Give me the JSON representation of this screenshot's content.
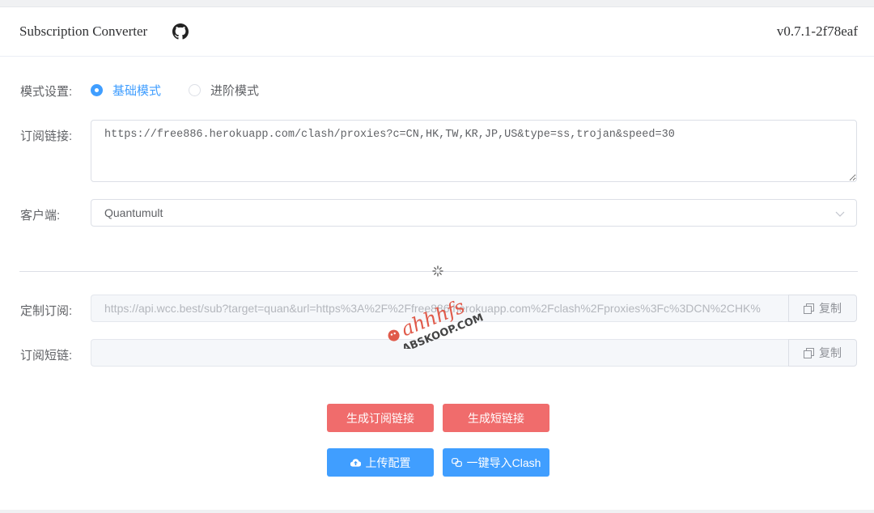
{
  "header": {
    "title": "Subscription Converter",
    "version": "v0.7.1-2f78eaf"
  },
  "form": {
    "mode": {
      "label": "模式设置:",
      "options": [
        {
          "label": "基础模式",
          "checked": true
        },
        {
          "label": "进阶模式",
          "checked": false
        }
      ]
    },
    "subscription": {
      "label": "订阅链接:",
      "value": "https://free886.herokuapp.com/clash/proxies?c=CN,HK,TW,KR,JP,US&type=ss,trojan&speed=30"
    },
    "client": {
      "label": "客户端:",
      "value": "Quantumult"
    },
    "custom": {
      "label": "定制订阅:",
      "value": "https://api.wcc.best/sub?target=quan&url=https%3A%2F%2Ffree886.herokuapp.com%2Fclash%2Fproxies%3Fc%3DCN%2CHK%",
      "copy_label": "复制"
    },
    "short": {
      "label": "订阅短链:",
      "value": "",
      "copy_label": "复制"
    }
  },
  "buttons": {
    "generate": "生成订阅链接",
    "shorten": "生成短链接",
    "upload": "上传配置",
    "import_clash": "一键导入Clash"
  },
  "watermark": {
    "line1": "ahhhfs",
    "line2": "ABSKOOP.COM"
  },
  "colors": {
    "primary": "#409eff",
    "danger": "#f06c6c",
    "text": "#606266",
    "border": "#dcdfe6"
  }
}
